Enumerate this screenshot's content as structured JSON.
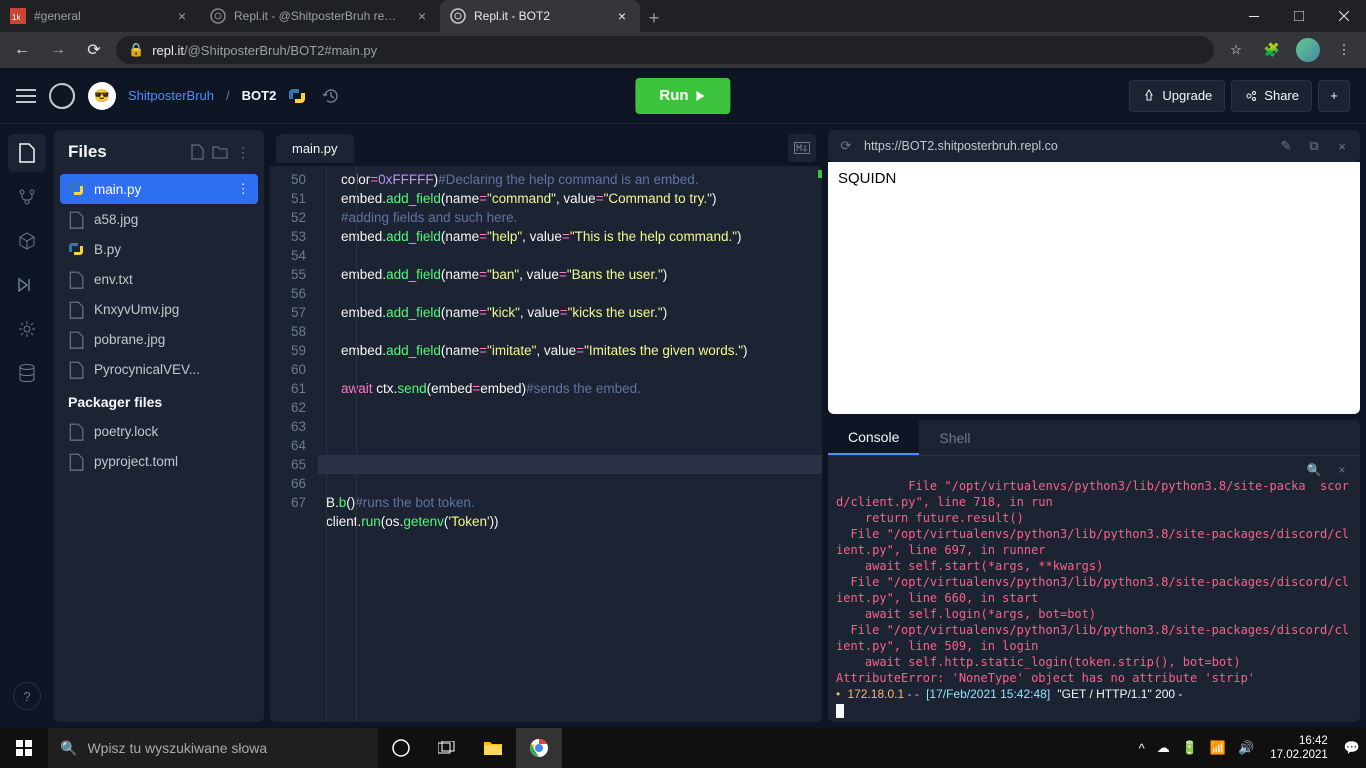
{
  "browser": {
    "tabs": [
      {
        "title": "#general",
        "icon": "discord"
      },
      {
        "title": "Repl.it - @ShitposterBruh remove",
        "icon": "replit"
      },
      {
        "title": "Repl.it - BOT2",
        "icon": "replit",
        "active": true
      }
    ],
    "url_host": "repl.it",
    "url_path": "/@ShitposterBruh/BOT2#main.py"
  },
  "repl": {
    "owner": "ShitposterBruh",
    "name": "BOT2",
    "run": "Run",
    "upgrade": "Upgrade",
    "share": "Share"
  },
  "files": {
    "title": "Files",
    "list": [
      {
        "name": "main.py",
        "type": "py",
        "active": true
      },
      {
        "name": "a58.jpg",
        "type": "file"
      },
      {
        "name": "B.py",
        "type": "py"
      },
      {
        "name": "env.txt",
        "type": "file"
      },
      {
        "name": "KnxyvUmv.jpg",
        "type": "file"
      },
      {
        "name": "pobrane.jpg",
        "type": "file"
      },
      {
        "name": "PyrocynicalVEV...",
        "type": "file"
      }
    ],
    "packager_title": "Packager files",
    "packager": [
      {
        "name": "poetry.lock"
      },
      {
        "name": "pyproject.toml"
      }
    ]
  },
  "editor": {
    "tab": "main.py",
    "first_line": 50
  },
  "webview": {
    "url": "https://BOT2.shitposterbruh.repl.co",
    "content": "SQUIDN"
  },
  "console": {
    "tab_console": "Console",
    "tab_shell": "Shell"
  },
  "taskbar": {
    "search": "Wpisz tu wyszukiwane słowa",
    "time": "16:42",
    "date": "17.02.2021"
  }
}
